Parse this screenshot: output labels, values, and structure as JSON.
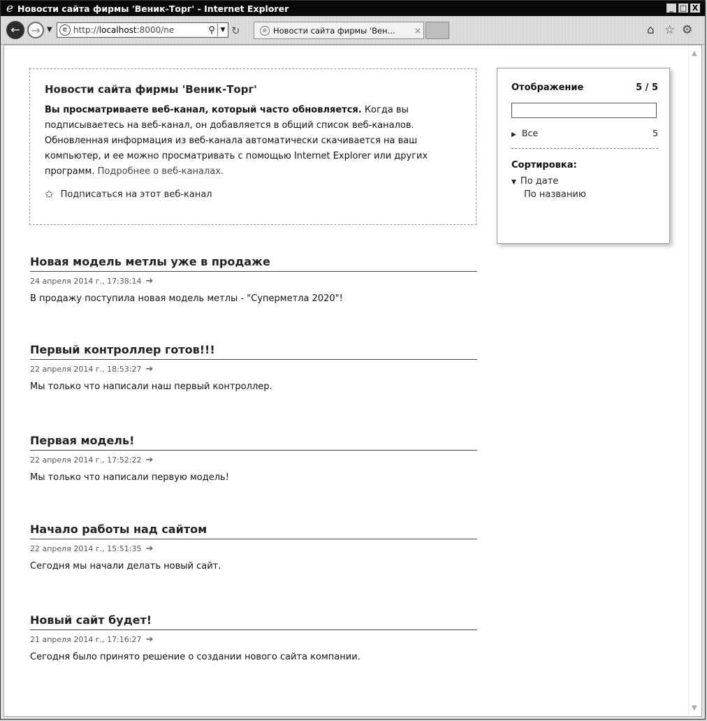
{
  "window": {
    "title": "Новости сайта фирмы 'Веник-Торг' - Internet Explorer",
    "minimize": "_",
    "maximize": "□",
    "close": "X"
  },
  "toolbar": {
    "url_prefix": "http://",
    "url_host": "localhost",
    "url_rest": ":8000/ne",
    "tab_title": "Новости сайта фирмы 'Вен...",
    "tab_close": "×"
  },
  "feed_info": {
    "title": "Новости сайта фирмы 'Веник-Торг'",
    "bold_text": "Вы просматриваете веб-канал, который часто обновляется.",
    "body_text": " Когда вы подписываетесь на веб-канал, он добавляется в общий список веб-каналов. Обновленная информация из веб-канала автоматически скачивается на ваш компьютер, и ее можно просматривать с помощью Internet Explorer или других программ. ",
    "more_link": "Подробнее о веб-каналах.",
    "subscribe_link": "Подписаться на этот веб-канал"
  },
  "sidebar": {
    "display_label": "Отображение",
    "display_count": "5 / 5",
    "filter_value": "",
    "all_label": "Все",
    "all_count": "5",
    "sort_label": "Сортировка:",
    "sort_by_date": "По дате",
    "sort_by_name": "По названию"
  },
  "articles": [
    {
      "title": "Новая модель метлы уже в продаже",
      "date": "24 апреля 2014 г., 17:38:14",
      "text": "В продажу поступила новая модель метлы - \"Суперметла 2020\"!"
    },
    {
      "title": "Первый контроллер готов!!!",
      "date": "22 апреля 2014 г., 18:53:27",
      "text": "Мы только что написали наш первый контроллер."
    },
    {
      "title": "Первая модель!",
      "date": "22 апреля 2014 г., 17:52:22",
      "text": "Мы только что написали первую модель!"
    },
    {
      "title": "Начало работы над сайтом",
      "date": "22 апреля 2014 г., 15:51:35",
      "text": "Сегодня мы начали делать новый сайт."
    },
    {
      "title": "Новый сайт будет!",
      "date": "21 апреля 2014 г., 17:16:27",
      "text": "Сегодня было принято решение о создании нового сайта компании."
    }
  ]
}
